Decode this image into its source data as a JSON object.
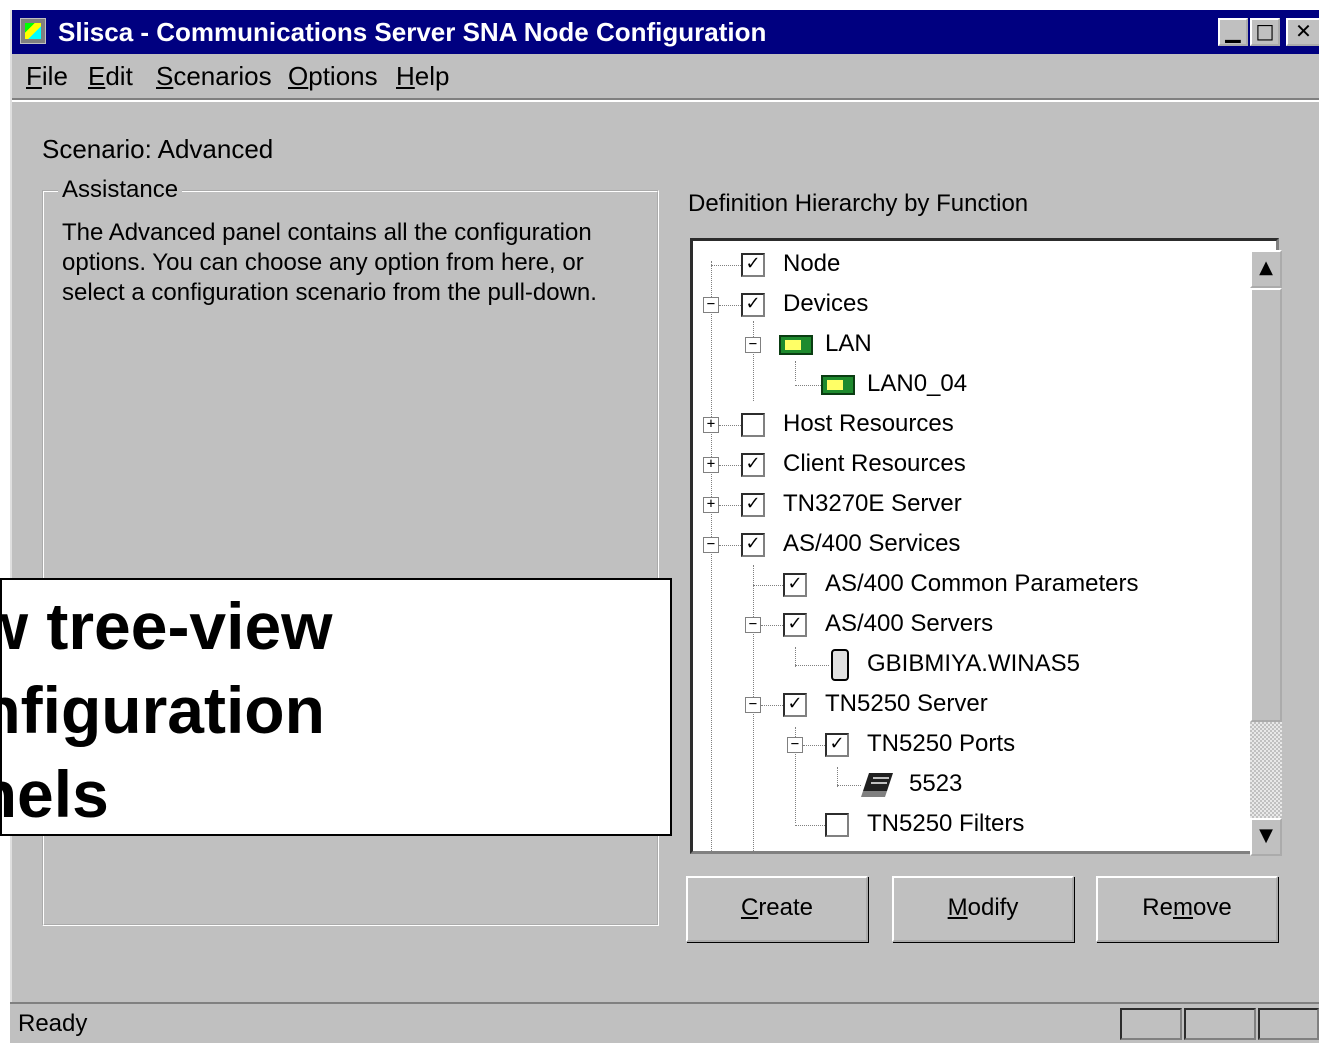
{
  "window": {
    "title": "Slisca - Communications Server SNA Node Configuration",
    "controls": {
      "minimize": "▁",
      "maximize": "□",
      "close": "✕"
    }
  },
  "menu": [
    {
      "key": "F",
      "rest": "ile"
    },
    {
      "key": "E",
      "rest": "dit"
    },
    {
      "key": "S",
      "rest": "cenarios"
    },
    {
      "key": "O",
      "rest": "ptions"
    },
    {
      "key": "H",
      "rest": "elp"
    }
  ],
  "scenario_label": "Scenario: Advanced",
  "assistance": {
    "legend": "Assistance",
    "text": "The Advanced panel contains all the configuration options. You can choose any option from here, or select a configuration scenario from the pull-down."
  },
  "hierarchy_label": "Definition Hierarchy by Function",
  "tree": [
    {
      "label": "Node",
      "checked": true
    },
    {
      "label": "Devices",
      "checked": true
    },
    {
      "label": "LAN",
      "icon": "lan-adapter-icon"
    },
    {
      "label": "LAN0_04",
      "icon": "lan-adapter-icon"
    },
    {
      "label": "Host Resources",
      "checked": false
    },
    {
      "label": "Client Resources",
      "checked": true
    },
    {
      "label": "TN3270E Server",
      "checked": true
    },
    {
      "label": "AS/400 Services",
      "checked": true
    },
    {
      "label": "AS/400 Common Parameters",
      "checked": true
    },
    {
      "label": "AS/400 Servers",
      "checked": true
    },
    {
      "label": "GBIBMIYA.WINAS5",
      "icon": "server-icon"
    },
    {
      "label": "TN5250 Server",
      "checked": true
    },
    {
      "label": "TN5250 Ports",
      "checked": true
    },
    {
      "label": "5523",
      "icon": "port-icon"
    },
    {
      "label": "TN5250 Filters",
      "checked": false
    }
  ],
  "buttons": {
    "create": {
      "key": "C",
      "rest": "reate"
    },
    "modify": {
      "key": "M",
      "rest": "odify"
    },
    "remove": {
      "pre": "Re",
      "key": "m",
      "rest": "ove"
    }
  },
  "status": "Ready",
  "overlay": {
    "line1": "ew tree-view",
    "line2": "onfiguration",
    "line3": "anels"
  },
  "colors": {
    "titlebar": "#000080",
    "face": "#c0c0c0"
  }
}
